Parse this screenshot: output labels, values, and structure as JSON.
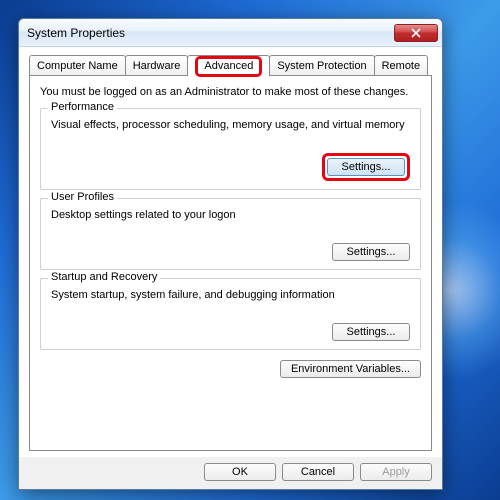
{
  "window": {
    "title": "System Properties"
  },
  "tabs": {
    "computer_name": "Computer Name",
    "hardware": "Hardware",
    "advanced": "Advanced",
    "system_protection": "System Protection",
    "remote": "Remote"
  },
  "intro": "You must be logged on as an Administrator to make most of these changes.",
  "performance": {
    "legend": "Performance",
    "desc": "Visual effects, processor scheduling, memory usage, and virtual memory",
    "settings_label": "Settings..."
  },
  "user_profiles": {
    "legend": "User Profiles",
    "desc": "Desktop settings related to your logon",
    "settings_label": "Settings..."
  },
  "startup_recovery": {
    "legend": "Startup and Recovery",
    "desc": "System startup, system failure, and debugging information",
    "settings_label": "Settings..."
  },
  "env_vars_label": "Environment Variables...",
  "dialog": {
    "ok": "OK",
    "cancel": "Cancel",
    "apply": "Apply"
  },
  "colors": {
    "highlight": "#e30613"
  }
}
